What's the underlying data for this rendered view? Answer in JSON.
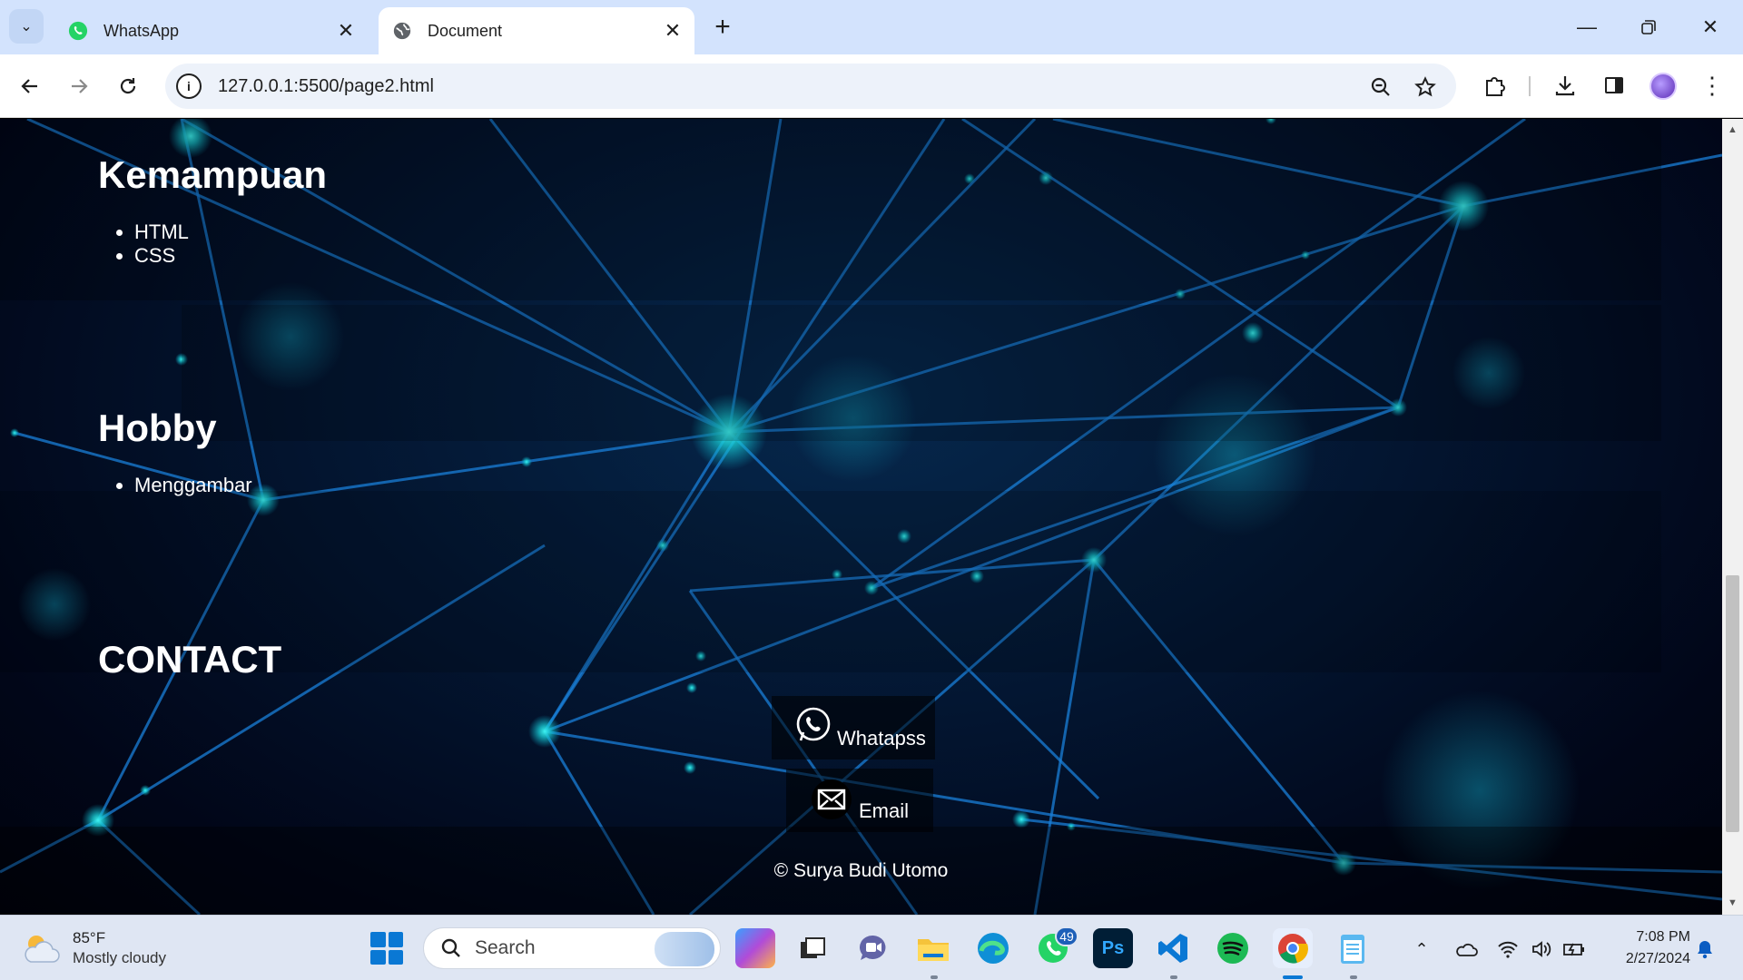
{
  "browser": {
    "tabs": [
      {
        "title": "WhatsApp",
        "active": false
      },
      {
        "title": "Document",
        "active": true
      }
    ],
    "address": "127.0.0.1:5500/page2.html"
  },
  "page": {
    "skills": {
      "title": "Kemampuan",
      "items": [
        "HTML",
        "CSS"
      ]
    },
    "hobby": {
      "title": "Hobby",
      "items": [
        "Menggambar"
      ]
    },
    "contact": {
      "title": "CONTACT",
      "whatsapp_label": "Whatapss",
      "email_label": "Email"
    },
    "footer": "© Surya Budi Utomo"
  },
  "taskbar": {
    "weather_temp": "85°F",
    "weather_desc": "Mostly cloudy",
    "search_label": "Search",
    "whatsapp_badge": "49",
    "time": "7:08 PM",
    "date": "2/27/2024"
  },
  "colors": {
    "tabstrip": "#d3e3fd",
    "accent": "#0a78d4",
    "network_line": "#1a7fd8",
    "node_glow": "#19d3d8"
  }
}
